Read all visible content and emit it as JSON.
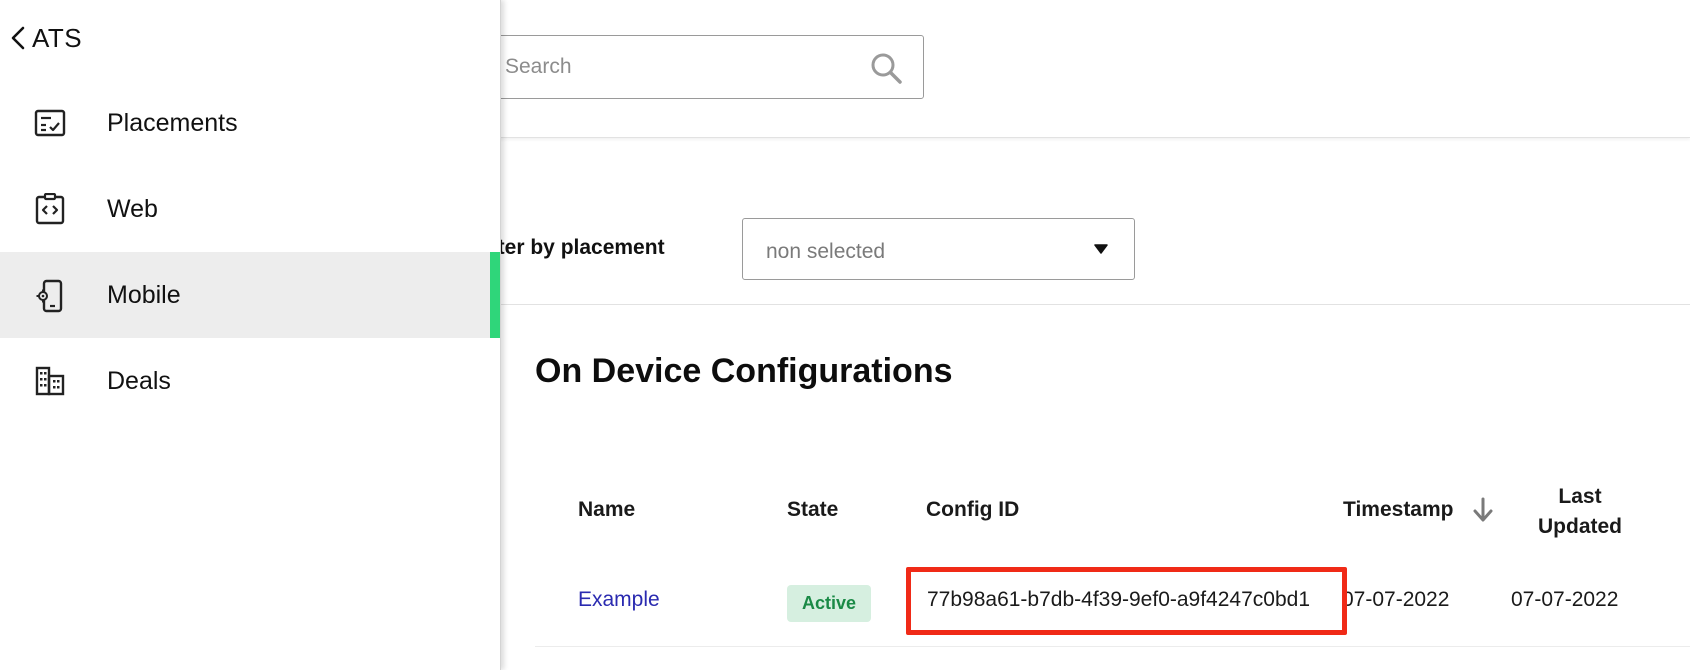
{
  "sidebar": {
    "back_label": "ATS",
    "items": [
      {
        "label": "Placements",
        "icon": "checklist-icon",
        "active": false
      },
      {
        "label": "Web",
        "icon": "code-page-icon",
        "active": false
      },
      {
        "label": "Mobile",
        "icon": "mobile-settings-icon",
        "active": true
      },
      {
        "label": "Deals",
        "icon": "building-icon",
        "active": false
      }
    ],
    "active_color": "#2fd67a"
  },
  "search": {
    "placeholder": "Search",
    "value": ""
  },
  "filter": {
    "label": "ilter by placement",
    "selected": "non selected"
  },
  "section": {
    "title": "On Device Configurations"
  },
  "table": {
    "columns": {
      "name": "Name",
      "state": "State",
      "config_id": "Config ID",
      "timestamp": "Timestamp",
      "last_updated": "Last Updated"
    },
    "sort": {
      "column": "Timestamp",
      "direction": "descending"
    },
    "rows": [
      {
        "name": "Example",
        "state": "Active",
        "config_id": "77b98a61-b7db-4f39-9ef0-a9f4247c0bd1",
        "timestamp": "07-07-2022",
        "last_updated": "07-07-2022"
      }
    ]
  },
  "colors": {
    "link": "#2a2ab0",
    "badge_bg": "#d6efe0",
    "badge_text": "#1a8a46",
    "highlight": "#f02a17"
  }
}
